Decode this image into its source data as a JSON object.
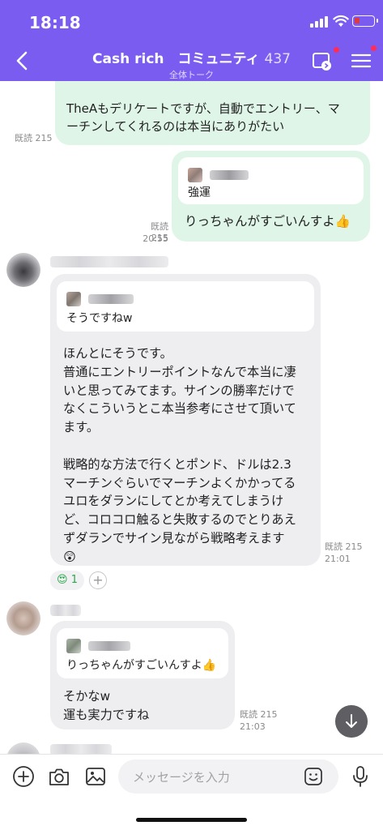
{
  "status_bar": {
    "time": "18:18"
  },
  "header": {
    "title": "Cash rich　コミュニティ",
    "member_count": "437",
    "subtitle": "全体トーク"
  },
  "messages": [
    {
      "sender": "me",
      "text_lines": [
        "TheAもデリケートですが、自動でエントリー、マ",
        "ーチンしてくれるのは本当にありがたい"
      ],
      "read_label": "既読 215"
    },
    {
      "sender": "me",
      "quote_text": "強運",
      "text": "りっちゃんがすごいんすよ👍",
      "read_label": "既読 215",
      "time": "20:55"
    },
    {
      "sender": "other",
      "quote_text": "そうですねw",
      "text_lines": [
        "ほんとにそうです。",
        "普通にエントリーポイントなんで本当に凄",
        "いと思ってみてます。サインの勝率だけで",
        "なくこういうとこ本当参考にさせて頂いて",
        "ます。",
        "",
        "戦略的な方法で行くとポンド、ドルは2.3",
        "マーチンぐらいでマーチンよくかかってる",
        "ユロをダランにしてとか考えてしまうけ",
        "ど、コロコロ触ると失敗するのでとりあえ",
        "ずダランでサイン見ながら戦略考えます",
        "😲"
      ],
      "read_label": "既読 215",
      "time": "21:01",
      "reaction": {
        "emoji": "😍",
        "count": "1",
        "add": "+"
      }
    },
    {
      "sender": "other",
      "quote_text": "りっちゃんがすごいんすよ👍",
      "text_lines": [
        "そかなw",
        "運も実力ですね"
      ],
      "read_label": "既読 215",
      "time": "21:03"
    }
  ],
  "input": {
    "placeholder": "メッセージを入力"
  },
  "colors": {
    "header": "#7b5cf0",
    "my_bubble": "#dff5e8",
    "their_bubble": "#eeeef1",
    "notification_dot": "#ff2d55"
  },
  "icons": [
    "back-icon",
    "video-call-icon",
    "menu-icon",
    "plus-icon",
    "camera-icon",
    "image-icon",
    "emoji-icon",
    "mic-icon",
    "arrow-down-icon"
  ]
}
